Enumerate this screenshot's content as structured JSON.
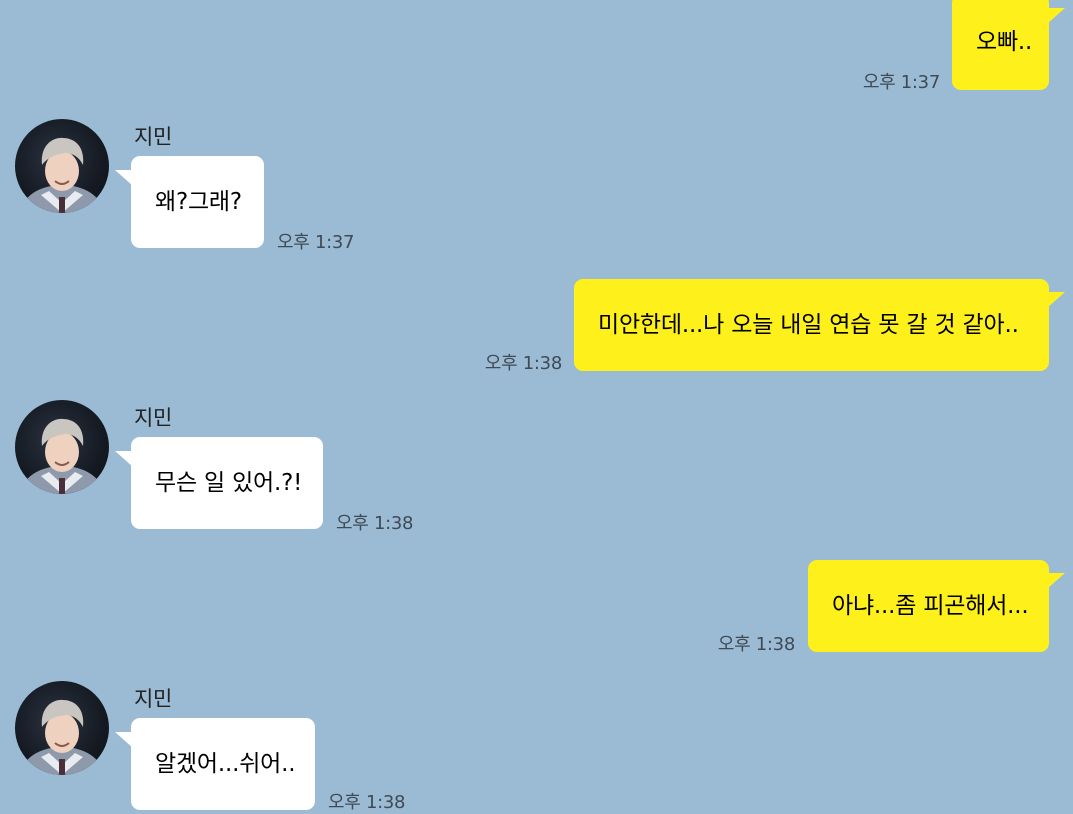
{
  "colors": {
    "background": "#9bbbd4",
    "outgoing_bubble": "#fef01b",
    "incoming_bubble": "#ffffff"
  },
  "messages": [
    {
      "direction": "out",
      "text": "오빠..",
      "time": "오후 1:37"
    },
    {
      "direction": "in",
      "sender": "지민",
      "avatar_icon": "profile-photo",
      "text": "왜?그래?",
      "time": "오후 1:37"
    },
    {
      "direction": "out",
      "text": "미안한데...나 오늘 내일 연습 못 갈 것 같아..",
      "time": "오후 1:38"
    },
    {
      "direction": "in",
      "sender": "지민",
      "avatar_icon": "profile-photo",
      "text": "무슨 일 있어.?!",
      "time": "오후 1:38"
    },
    {
      "direction": "out",
      "text": "아냐...좀 피곤해서...",
      "time": "오후 1:38"
    },
    {
      "direction": "in",
      "sender": "지민",
      "avatar_icon": "profile-photo",
      "text": "알겠어...쉬어..",
      "time": "오후 1:38"
    }
  ]
}
